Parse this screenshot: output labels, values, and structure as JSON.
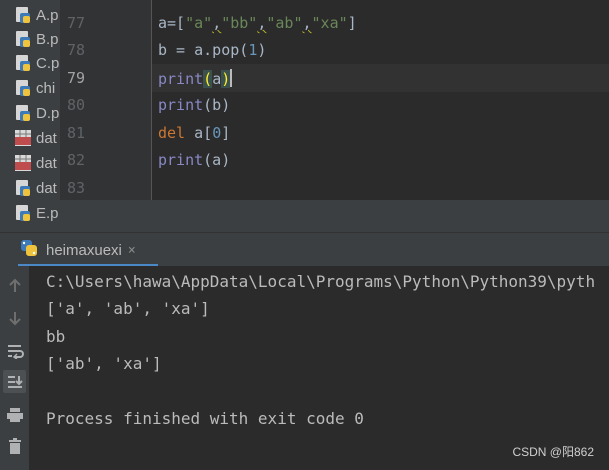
{
  "project_tree": {
    "items": [
      {
        "name": "A.p",
        "icon": "python-file-icon"
      },
      {
        "name": "B.p",
        "icon": "python-file-icon"
      },
      {
        "name": "C.p",
        "icon": "python-file-icon"
      },
      {
        "name": "chi",
        "icon": "python-file-icon"
      },
      {
        "name": "D.p",
        "icon": "python-file-icon"
      },
      {
        "name": "dat",
        "icon": "csv-file-icon"
      },
      {
        "name": "dat",
        "icon": "csv-file-icon"
      },
      {
        "name": "dat",
        "icon": "python-file-icon"
      },
      {
        "name": "E.p",
        "icon": "python-file-icon"
      }
    ]
  },
  "editor": {
    "line_numbers": [
      "77",
      "78",
      "79",
      "80",
      "81",
      "82",
      "83"
    ],
    "current_line": "79",
    "code": {
      "l77": {
        "prefix": "a=[",
        "s1": "\"a\"",
        "s2": "\"bb\"",
        "s3": "\"ab\"",
        "s4": "\"xa\"",
        "comma": ",",
        "suffix": "]"
      },
      "l78": {
        "prefix": "b = a.pop(",
        "num": "1",
        "suffix": ")"
      },
      "l79": {
        "kw": "print",
        "open": "(",
        "arg": "a",
        "close": ")"
      },
      "l80": {
        "kw": "print",
        "rest": "(b)"
      },
      "l81": {
        "kw": "del",
        "rest": " a[",
        "num": "0",
        "close": "]"
      },
      "l82": {
        "kw": "print",
        "rest": "(a)"
      }
    }
  },
  "run_tab": {
    "label": "heimaxuexi",
    "close": "×",
    "icon": "python-run-icon"
  },
  "console": {
    "lines": [
      "C:\\Users\\hawa\\AppData\\Local\\Programs\\Python\\Python39\\pyth",
      "['a', 'ab', 'xa']",
      "bb",
      "['ab', 'xa']",
      "",
      "Process finished with exit code 0"
    ],
    "tools": [
      "up-arrow-icon",
      "down-arrow-icon",
      "soft-wrap-icon",
      "scroll-to-end-icon",
      "print-icon",
      "trash-icon"
    ]
  },
  "watermark": "CSDN @阳862",
  "colors": {
    "accent": "#4a88c7",
    "keyword_builtin": "#8888c6",
    "keyword": "#cc7832",
    "string": "#6a8759",
    "number": "#6897bb",
    "text": "#a9b7c6"
  }
}
